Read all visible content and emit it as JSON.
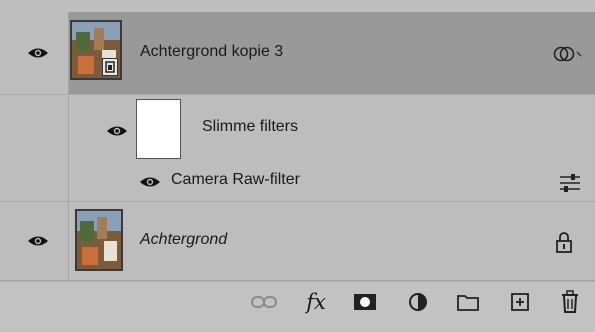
{
  "layers": {
    "top": {
      "name": "Achtergrond kopie 3",
      "visible": true,
      "selected": true,
      "type": "smart-object",
      "status_icon": "smart-filter-icon"
    },
    "smart_filters": {
      "name": "Slimme filters",
      "visible": true
    },
    "filter": {
      "name": "Camera Raw-filter",
      "visible": true,
      "options_icon": "filter-options-icon"
    },
    "background": {
      "name": "Achtergrond",
      "visible": true,
      "locked": true
    }
  },
  "footer": {
    "icons": [
      "link-icon",
      "fx-icon",
      "mask-icon",
      "adjustment-icon",
      "folder-icon",
      "new-layer-icon",
      "trash-icon"
    ],
    "fx_label": "fx"
  },
  "colors": {
    "panel": "#bebebe",
    "selected_row": "#999999",
    "border": "#a6a6a6"
  }
}
